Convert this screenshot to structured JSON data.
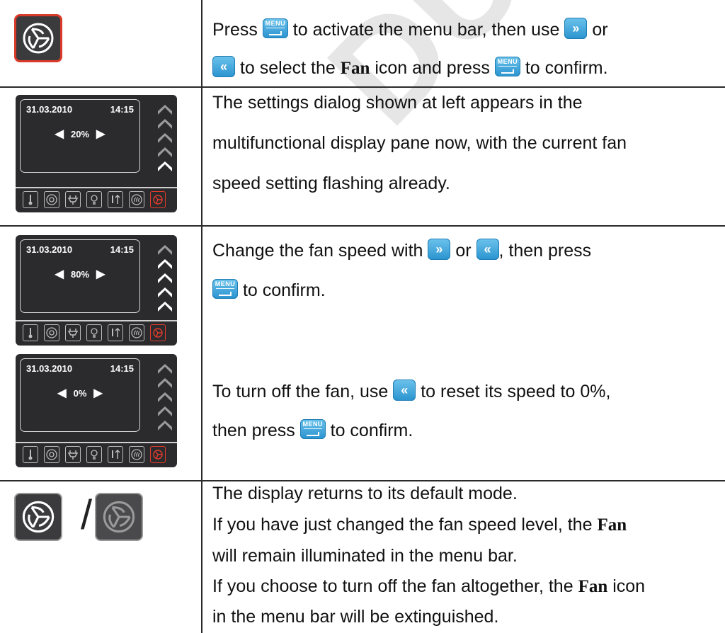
{
  "watermark": "DUTSCHER",
  "rows": [
    {
      "lines": [
        {
          "pre": "Press ",
          "btn1": "menu",
          "mid": " to activate the menu bar, then use ",
          "btn2": "right",
          "post": " or"
        },
        {
          "btn1": "left",
          "pre2": " to select the ",
          "bold": "Fan",
          "mid": " icon and press ",
          "btn2": "menu",
          "post": " to confirm."
        }
      ]
    },
    {
      "panel": {
        "date": "31.03.2010",
        "time": "14:15",
        "speed": "20%",
        "level": 1
      },
      "lines": [
        "The settings dialog shown at left appears in the",
        "multifunctional display pane now, with the current fan",
        "speed setting flashing already."
      ]
    },
    {
      "panels": [
        {
          "date": "31.03.2010",
          "time": "14:15",
          "speed": "80%",
          "level": 4
        },
        {
          "date": "31.03.2010",
          "time": "14:15",
          "speed": "0%",
          "level": 0
        }
      ],
      "line1": {
        "pre": "Change the fan speed with ",
        "mid": " or ",
        "post": ", then press"
      },
      "line2": {
        "post": " to confirm."
      },
      "line3": {
        "pre": "To turn off the fan, use ",
        "post": " to reset its speed to 0%,"
      },
      "line4": {
        "pre": "then press ",
        "post": " to confirm."
      }
    },
    {
      "slash": "/",
      "line1": "The display returns to its default mode.",
      "line2a": "If you have just changed the fan speed level, the ",
      "line2b": "Fan",
      "line3": "will remain illuminated in the menu bar.",
      "line4a": "If you choose to turn off the fan altogether, the ",
      "line4b": "Fan",
      "line4c": " icon",
      "line5": "in the menu bar will be extinguished."
    }
  ],
  "buttons": {
    "menu": "MENU",
    "right": "»",
    "left": "«"
  },
  "colors": {
    "button": "#2a93cf",
    "panel": "#2b2b2d",
    "active_icon": "#e53b2c"
  },
  "icons": [
    "thermometer-icon",
    "target-icon",
    "plug-icon",
    "bulb-icon",
    "temp-arrows-icon",
    "steam-icon",
    "fan-icon"
  ]
}
